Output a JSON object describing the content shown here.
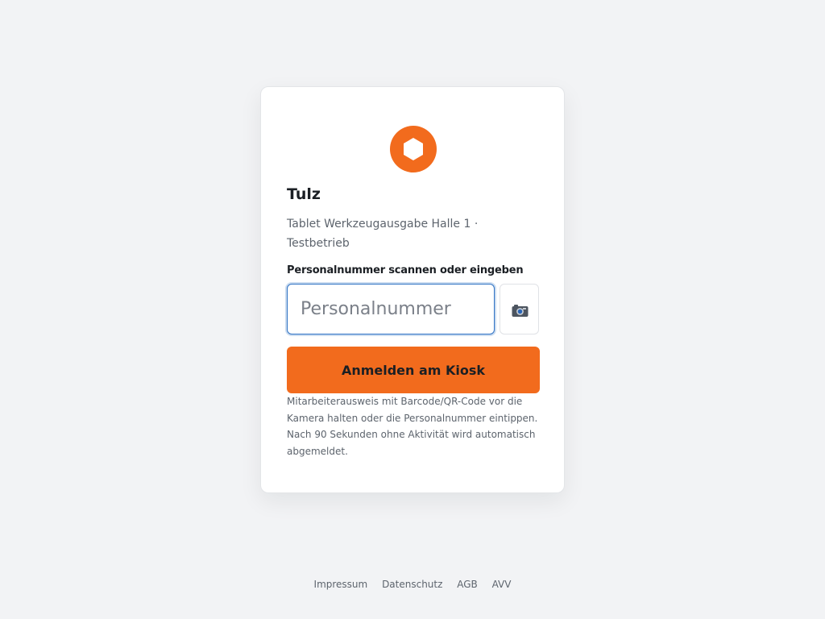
{
  "card": {
    "logo_icon": "hexagon-icon",
    "brand_color": "#f26b1d",
    "brand": "Tulz",
    "subtitle": "Tablet Werkzeugausgabe Halle 1 · Testbetrieb",
    "field_label": "Personalnummer scannen oder eingeben",
    "input": {
      "value": "",
      "placeholder": "Personalnummer"
    },
    "camera_button_icon": "camera-icon",
    "submit_label": "Anmelden am Kiosk",
    "hint": "Mitarbeiterausweis mit Barcode/QR-Code vor die Kamera halten oder die Personalnummer eintippen. Nach 90 Sekunden ohne Aktivität wird automatisch abgemeldet."
  },
  "footer": {
    "links": [
      "Impressum",
      "Datenschutz",
      "AGB",
      "AVV"
    ]
  }
}
